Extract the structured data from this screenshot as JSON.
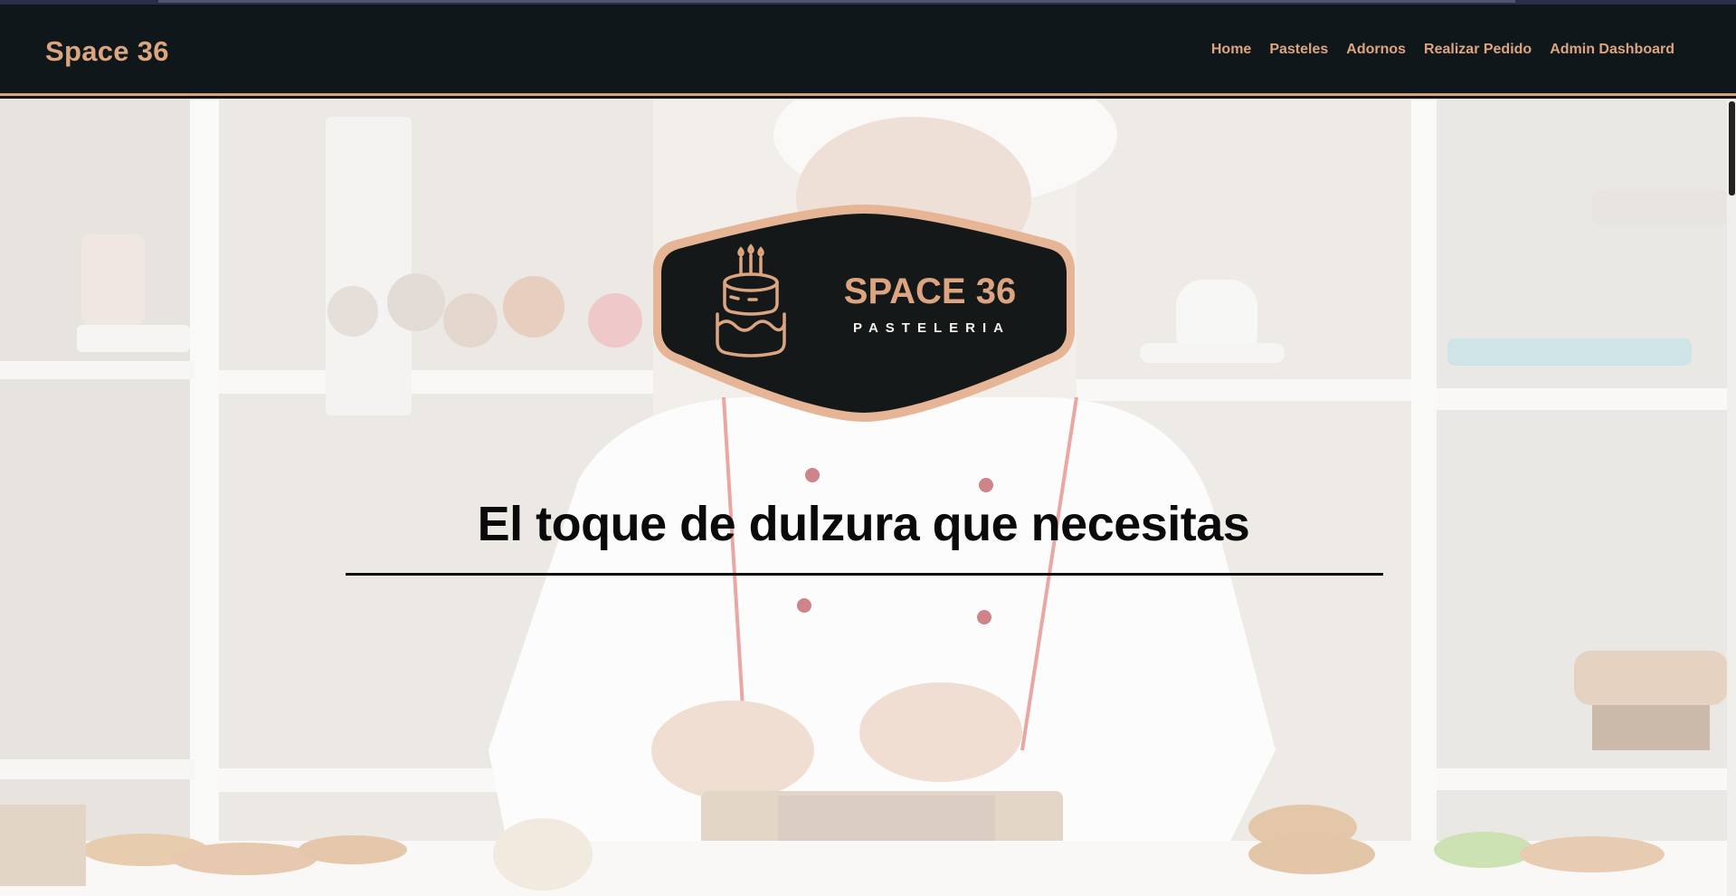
{
  "navbar": {
    "brand": "Space 36",
    "links": [
      {
        "label": "Home"
      },
      {
        "label": "Pasteles"
      },
      {
        "label": "Adornos"
      },
      {
        "label": "Realizar Pedido"
      },
      {
        "label": "Admin Dashboard"
      }
    ]
  },
  "hero": {
    "logo": {
      "name": "SPACE 36",
      "tagline": "PASTELERIA",
      "icon": "birthday-cake-icon"
    },
    "title": "El toque de dulzura que necesitas"
  },
  "colors": {
    "nav_bg": "#10171b",
    "accent": "#dca57f",
    "badge_bg": "#141819",
    "badge_border": "#e6b596"
  }
}
